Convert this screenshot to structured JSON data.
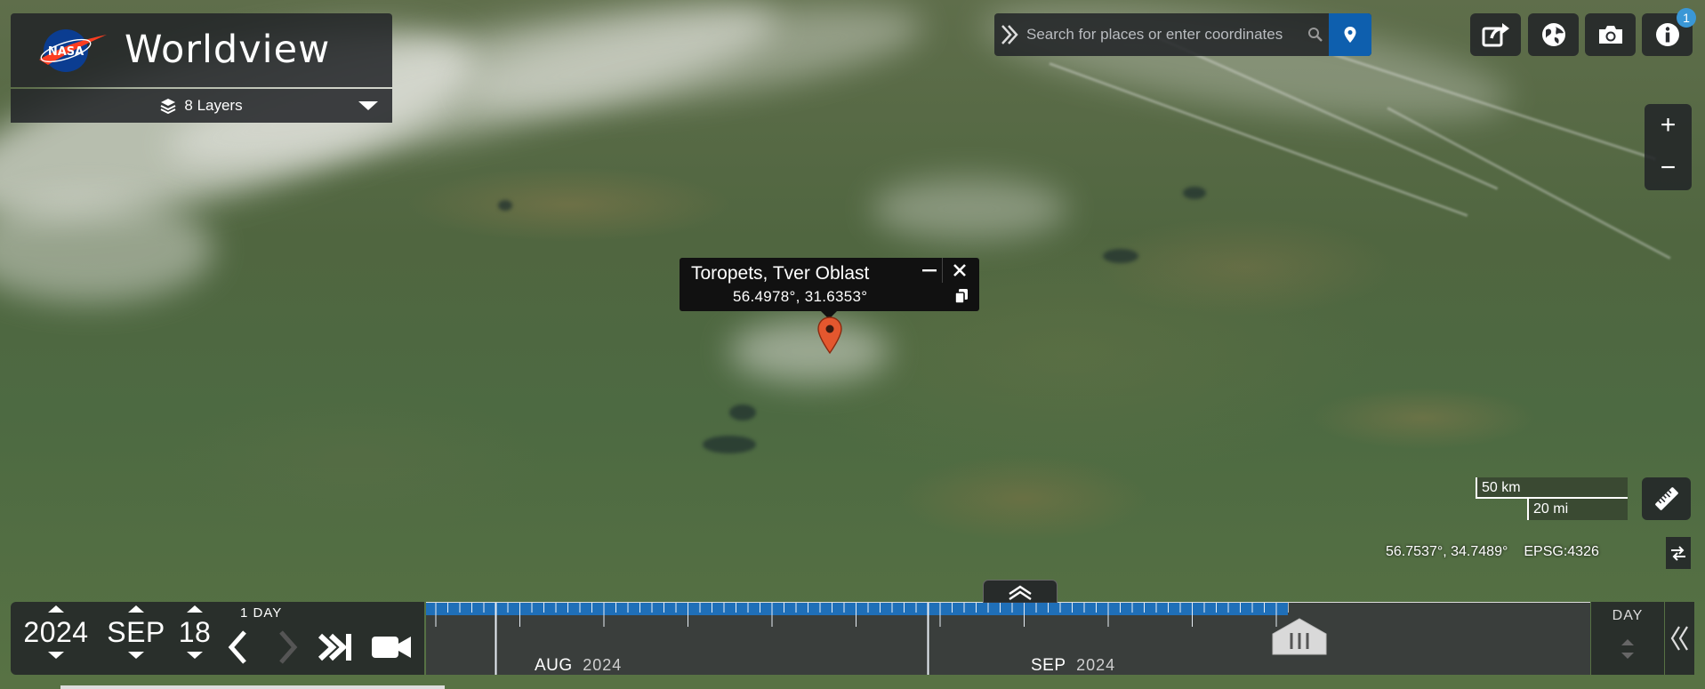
{
  "brand": {
    "title": "Worldview",
    "logo_text": "NASA"
  },
  "layers": {
    "label": "8 Layers"
  },
  "search": {
    "placeholder": "Search for places or enter coordinates"
  },
  "toolbar": {
    "icons": [
      "share-icon",
      "projection-globe-icon",
      "camera-icon",
      "info-icon"
    ],
    "info_badge": "1"
  },
  "zoom": {
    "in_label": "+",
    "out_label": "−"
  },
  "popup": {
    "title": "Toropets, Tver Oblast",
    "coords": "56.4978°, 31.6353°",
    "minimize_label": "−",
    "close_label": "✕"
  },
  "scale": {
    "km": "50 km",
    "mi": "20 mi"
  },
  "coordinates": {
    "value": "56.7537°, 34.7489°",
    "projection": "EPSG:4326"
  },
  "date": {
    "year": "2024",
    "month": "SEP",
    "day": "18",
    "interval": "1 DAY"
  },
  "timeline": {
    "months": [
      {
        "name": "AUG",
        "year": "2024"
      },
      {
        "name": "SEP",
        "year": "2024"
      }
    ],
    "zoom_level": "DAY"
  },
  "colors": {
    "accent": "#0e5fae",
    "timeline_bar": "#1f6fb8",
    "marker": "#e4572e"
  }
}
